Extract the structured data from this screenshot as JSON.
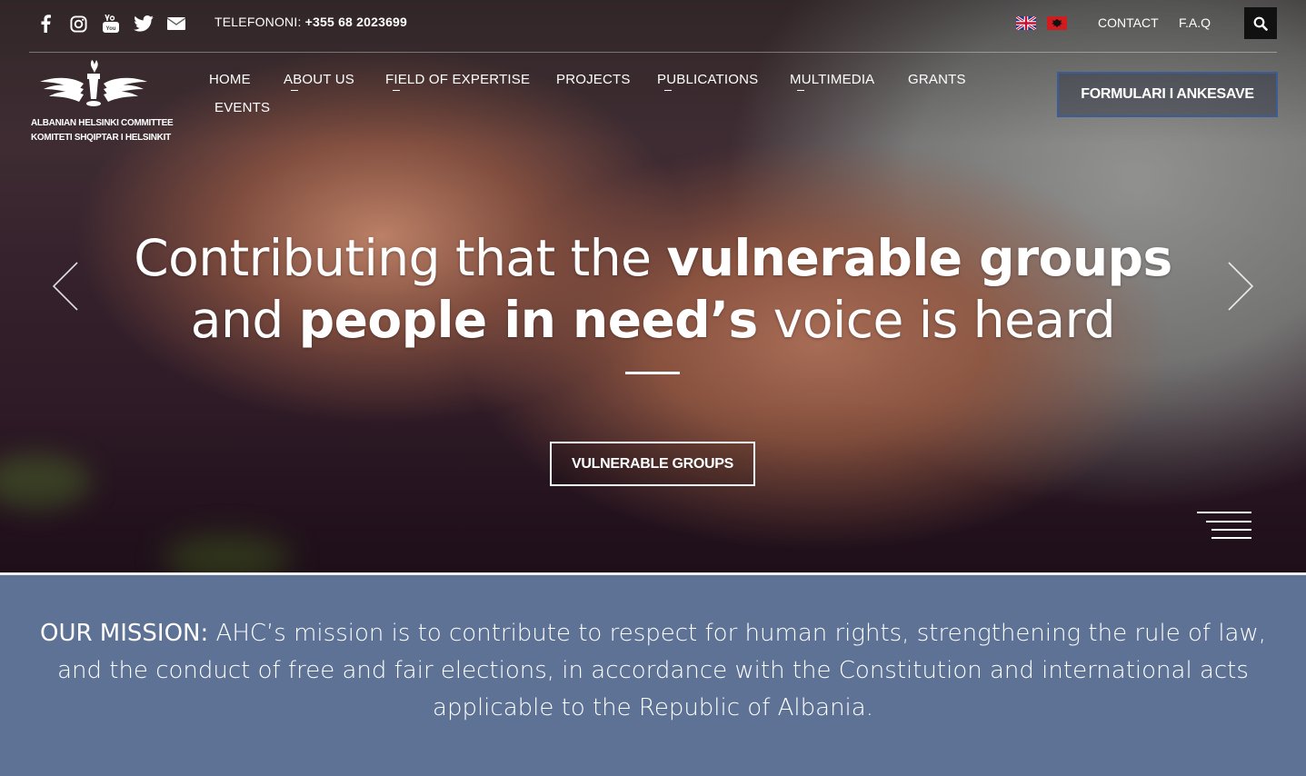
{
  "social": [
    "facebook-icon",
    "instagram-icon",
    "youtube-icon",
    "twitter-icon",
    "mail-icon"
  ],
  "phone": {
    "label": "TELEFONONI:",
    "number": "+355 68 2023699"
  },
  "languages": [
    "english-flag-icon",
    "albanian-flag-icon"
  ],
  "toplinks": {
    "contact": "CONTACT",
    "faq": "F.A.Q"
  },
  "logo": {
    "line1": "ALBANIAN HELSINKI COMMITTEE",
    "line2": "KOMITETI SHQIPTAR I HELSINKIT"
  },
  "nav": {
    "home": "HOME",
    "about": "ABOUT US",
    "expertise": "FIELD OF EXPERTISE",
    "projects": "PROJECTS",
    "publications": "PUBLICATIONS",
    "multimedia": "MULTIMEDIA",
    "grants": "GRANTS",
    "events": "EVENTS"
  },
  "cta": "FORMULARI I ANKESAVE",
  "hero": {
    "line1_a": "Contributing that the ",
    "line1_b": "vulnerable groups",
    "line2_a": "and ",
    "line2_b": "people in need’s",
    "line2_c": " voice is heard",
    "button": "VULNERABLE GROUPS"
  },
  "mission": {
    "label": "OUR MISSION:",
    "text": " AHC’s mission is to contribute to respect for human rights, strengthening the rule of law, and the conduct of free and fair elections, in accordance with the Constitution and international acts applicable to the Republic of Albania."
  },
  "colors": {
    "mission_bg": "#5d7294",
    "cta_border": "#3d5b98"
  }
}
